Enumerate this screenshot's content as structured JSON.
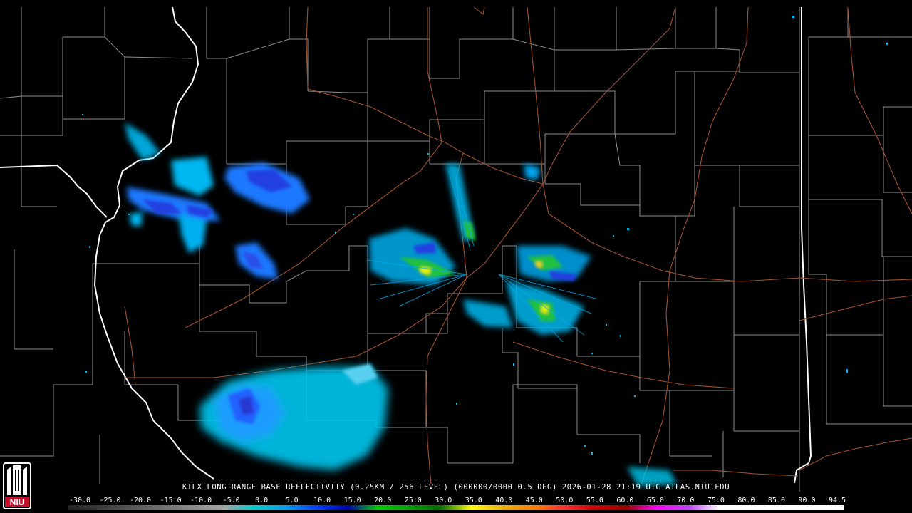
{
  "product": {
    "title": "KILX LONG RANGE BASE REFLECTIVITY (0.25KM / 256 LEVEL) (000000/0000 0.5 DEG) 2026-01-28 21:19 UTC  ATLAS.NIU.EDU"
  },
  "logo": {
    "text": "NIU",
    "color": "#c8102e"
  },
  "colors": {
    "background": "#000000",
    "county_lines": "#8c8c8c",
    "state_lines": "#ffffff",
    "roads": "#a0522d"
  },
  "scale": {
    "labels": [
      "-30.0",
      "-25.0",
      "-20.0",
      "-15.0",
      "-10.0",
      "-5.0",
      "0.0",
      "5.0",
      "10.0",
      "15.0",
      "20.0",
      "25.0",
      "30.0",
      "35.0",
      "40.0",
      "45.0",
      "50.0",
      "55.0",
      "60.0",
      "65.0",
      "70.0",
      "75.0",
      "80.0",
      "85.0",
      "90.0",
      "94.5"
    ],
    "colors": [
      "#222222",
      "#3a3a3a",
      "#555555",
      "#707070",
      "#8a8a8a",
      "#a5a5a5",
      "#00cccc",
      "#00a0f0",
      "#0040ff",
      "#0000b0",
      "#00d000",
      "#00a000",
      "#007000",
      "#ffff00",
      "#f0b000",
      "#ff8000",
      "#ff3030",
      "#d00000",
      "#a00000",
      "#ff00ff",
      "#c040ff",
      "#ffffff",
      "#ffffff",
      "#ffffff",
      "#ffffff"
    ]
  }
}
